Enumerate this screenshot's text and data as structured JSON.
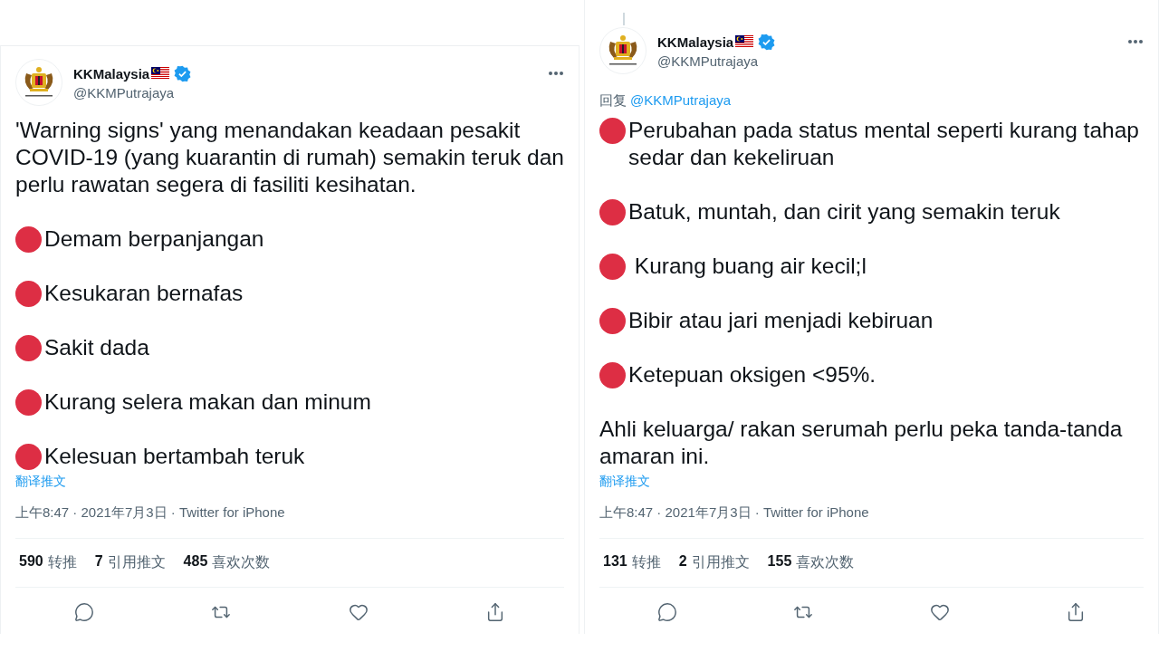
{
  "tweets": [
    {
      "name": "KKMalaysia",
      "handle": "@KKMPutrajaya",
      "thread_line": false,
      "body": [
        {
          "kind": "text",
          "text": "'Warning signs' yang menandakan keadaan pesakit COVID-19 (yang kuarantin di rumah) semakin teruk dan perlu rawatan segera di fasiliti kesihatan."
        },
        {
          "kind": "bullet",
          "text": "Demam berpanjangan"
        },
        {
          "kind": "bullet",
          "text": "Kesukaran bernafas"
        },
        {
          "kind": "bullet",
          "text": "Sakit dada"
        },
        {
          "kind": "bullet",
          "text": "Kurang selera makan dan minum"
        },
        {
          "kind": "bullet",
          "text": "Kelesuan bertambah teruk"
        }
      ],
      "translate": "翻译推文",
      "meta": "上午8:47 · 2021年7月3日 · Twitter for iPhone",
      "stats": [
        {
          "count": "590",
          "label": "转推"
        },
        {
          "count": "7",
          "label": "引用推文"
        },
        {
          "count": "485",
          "label": "喜欢次数"
        }
      ]
    },
    {
      "name": "KKMalaysia",
      "handle": "@KKMPutrajaya",
      "thread_line": true,
      "reply_prefix": "回复",
      "reply_to": "@KKMPutrajaya",
      "body": [
        {
          "kind": "bullet",
          "text": "Perubahan pada status mental seperti kurang tahap sedar dan kekeliruan"
        },
        {
          "kind": "bullet",
          "text": "Batuk, muntah, dan cirit yang semakin teruk"
        },
        {
          "kind": "bullet",
          "text": " Kurang buang air kecil;l"
        },
        {
          "kind": "bullet",
          "text": "Bibir atau jari menjadi kebiruan"
        },
        {
          "kind": "bullet",
          "text": "Ketepuan oksigen <95%."
        },
        {
          "kind": "text",
          "text": "Ahli keluarga/ rakan serumah perlu peka tanda-tanda amaran ini."
        }
      ],
      "translate": "翻译推文",
      "meta": "上午8:47 · 2021年7月3日 · Twitter for iPhone",
      "stats": [
        {
          "count": "131",
          "label": "转推"
        },
        {
          "count": "2",
          "label": "引用推文"
        },
        {
          "count": "155",
          "label": "喜欢次数"
        }
      ]
    }
  ]
}
